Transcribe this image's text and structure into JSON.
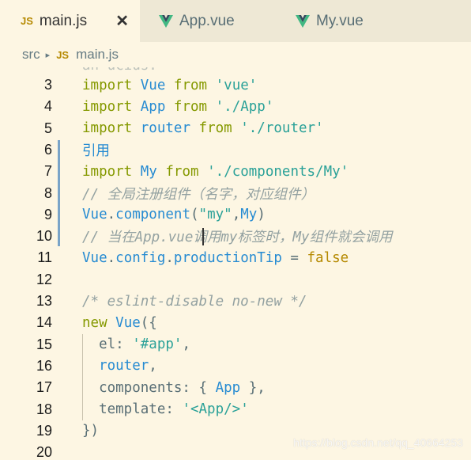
{
  "tabs": [
    {
      "icon": "JS",
      "label": "main.js",
      "close": "✕",
      "active": true
    },
    {
      "icon": "vue-icon",
      "label": "App.vue",
      "active": false
    },
    {
      "icon": "vue-icon",
      "label": "My.vue",
      "active": false
    }
  ],
  "breadcrumb": {
    "folder": "src",
    "separator": "▸",
    "file_icon": "JS",
    "file": "main.js"
  },
  "code_lines": [
    {
      "n": "3",
      "segs": [
        [
          "kw",
          "import"
        ],
        [
          "plain",
          " "
        ],
        [
          "id",
          "Vue"
        ],
        [
          "plain",
          " "
        ],
        [
          "kw",
          "from"
        ],
        [
          "plain",
          " "
        ],
        [
          "str",
          "'vue'"
        ]
      ]
    },
    {
      "n": "4",
      "segs": [
        [
          "kw",
          "import"
        ],
        [
          "plain",
          " "
        ],
        [
          "id",
          "App"
        ],
        [
          "plain",
          " "
        ],
        [
          "kw",
          "from"
        ],
        [
          "plain",
          " "
        ],
        [
          "str",
          "'./App'"
        ]
      ]
    },
    {
      "n": "5",
      "segs": [
        [
          "kw",
          "import"
        ],
        [
          "plain",
          " "
        ],
        [
          "id",
          "router"
        ],
        [
          "plain",
          " "
        ],
        [
          "kw",
          "from"
        ],
        [
          "plain",
          " "
        ],
        [
          "str",
          "'./router'"
        ]
      ]
    },
    {
      "n": "6",
      "segs": [
        [
          "id",
          "引用"
        ]
      ]
    },
    {
      "n": "7",
      "segs": [
        [
          "kw",
          "import"
        ],
        [
          "plain",
          " "
        ],
        [
          "id",
          "My"
        ],
        [
          "plain",
          " "
        ],
        [
          "kw",
          "from"
        ],
        [
          "plain",
          " "
        ],
        [
          "str",
          "'./components/My'"
        ]
      ]
    },
    {
      "n": "8",
      "segs": [
        [
          "cm",
          "// 全局注册组件（名字，对应组件）"
        ]
      ]
    },
    {
      "n": "9",
      "segs": [
        [
          "id",
          "Vue"
        ],
        [
          "plain",
          "."
        ],
        [
          "fn",
          "component"
        ],
        [
          "plain",
          "("
        ],
        [
          "str",
          "\"my\""
        ],
        [
          "plain",
          ","
        ],
        [
          "id",
          "My"
        ],
        [
          "plain",
          ")"
        ]
      ]
    },
    {
      "n": "10",
      "segs": [
        [
          "cm",
          "// 当在App.vue调用my标签时，My组件就会调用"
        ]
      ]
    },
    {
      "n": "11",
      "segs": [
        [
          "id",
          "Vue"
        ],
        [
          "plain",
          "."
        ],
        [
          "fn",
          "config"
        ],
        [
          "plain",
          "."
        ],
        [
          "fn",
          "productionTip"
        ],
        [
          "plain",
          " = "
        ],
        [
          "bool",
          "false"
        ]
      ]
    },
    {
      "n": "12",
      "segs": []
    },
    {
      "n": "13",
      "segs": [
        [
          "cm",
          "/* eslint-disable no-new */"
        ]
      ]
    },
    {
      "n": "14",
      "segs": [
        [
          "kw",
          "new"
        ],
        [
          "plain",
          " "
        ],
        [
          "id",
          "Vue"
        ],
        [
          "plain",
          "({"
        ]
      ]
    },
    {
      "n": "15",
      "segs": [
        [
          "plain",
          "  el: "
        ],
        [
          "str",
          "'#app'"
        ],
        [
          "plain",
          ","
        ]
      ]
    },
    {
      "n": "16",
      "segs": [
        [
          "plain",
          "  "
        ],
        [
          "id",
          "router"
        ],
        [
          "plain",
          ","
        ]
      ]
    },
    {
      "n": "17",
      "segs": [
        [
          "plain",
          "  components: { "
        ],
        [
          "id",
          "App"
        ],
        [
          "plain",
          " },"
        ]
      ]
    },
    {
      "n": "18",
      "segs": [
        [
          "plain",
          "  template: "
        ],
        [
          "str",
          "'<App/>'"
        ]
      ]
    },
    {
      "n": "19",
      "segs": [
        [
          "plain",
          "})"
        ]
      ]
    },
    {
      "n": "20",
      "segs": []
    }
  ],
  "partial_top_text": "an ucius.",
  "watermark": "https://blog.csdn.net/qq_40664253",
  "colors": {
    "keyword": "#859900",
    "identifier": "#268bd2",
    "string": "#2aa198",
    "comment": "#93a1a1",
    "bool": "#b58900",
    "bg": "#fdf6e3",
    "tabbar": "#eee8d5",
    "modified_gutter": "#7aa4c8"
  }
}
